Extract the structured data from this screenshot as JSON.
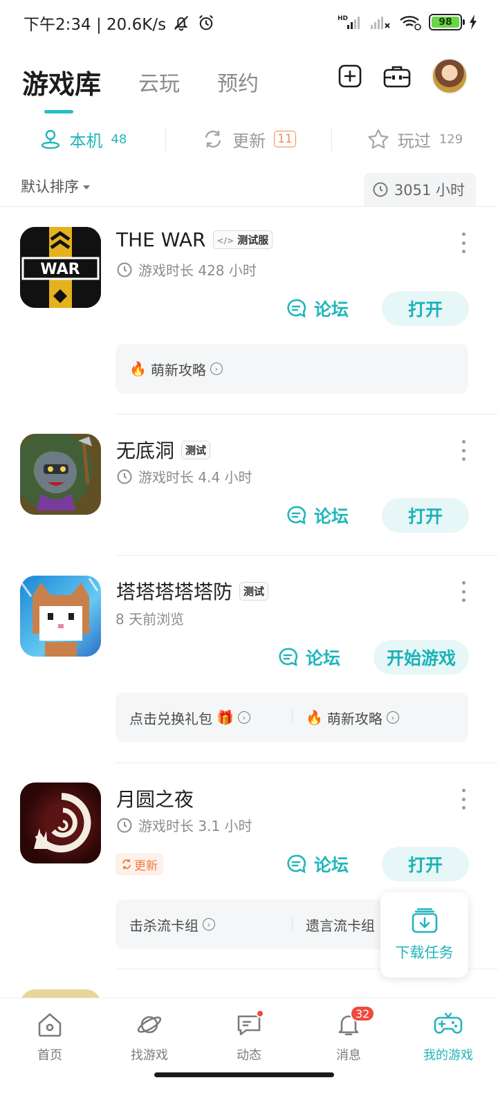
{
  "status_bar": {
    "time_speed": "下午2:34 | 20.6K/s",
    "battery": "98",
    "network": "HD"
  },
  "top_tabs": [
    {
      "label": "游戏库",
      "active": true
    },
    {
      "label": "云玩",
      "active": false
    },
    {
      "label": "预约",
      "active": false
    }
  ],
  "top_actions": {
    "add_icon": "plus-square-icon",
    "toolbox_icon": "toolbox-icon"
  },
  "sub_tabs": [
    {
      "label": "本机",
      "count": "48",
      "icon": "phone-user-icon",
      "active": true
    },
    {
      "label": "更新",
      "count": "11",
      "icon": "refresh-icon",
      "active": false
    },
    {
      "label": "玩过",
      "count": "129",
      "icon": "star-icon",
      "active": false
    }
  ],
  "sort": {
    "label": "默认排序",
    "total_time": "3051 小时"
  },
  "games": [
    {
      "title": "THE WAR",
      "tag": "测试服",
      "meta": "游戏时长 428 小时",
      "forum": "论坛",
      "action": "打开",
      "guides": [
        "萌新攻略"
      ]
    },
    {
      "title": "无底洞",
      "tag": "测试",
      "meta": "游戏时长 4.4 小时",
      "forum": "论坛",
      "action": "打开",
      "guides": []
    },
    {
      "title": "塔塔塔塔塔防",
      "tag": "测试",
      "meta": "8 天前浏览",
      "forum": "论坛",
      "action": "开始游戏",
      "guides": [
        "点击兑换礼包",
        "萌新攻略"
      ]
    },
    {
      "title": "月圆之夜",
      "tag": "",
      "meta": "游戏时长 3.1 小时",
      "update": "更新",
      "forum": "论坛",
      "action": "打开",
      "guides": [
        "击杀流卡组",
        "遗言流卡组"
      ]
    }
  ],
  "download_fab": {
    "label": "下载任务"
  },
  "bottom_nav": [
    {
      "label": "首页",
      "icon": "home-icon",
      "active": false
    },
    {
      "label": "找游戏",
      "icon": "planet-icon",
      "active": false
    },
    {
      "label": "动态",
      "icon": "chat-icon",
      "active": false,
      "dot": true
    },
    {
      "label": "消息",
      "icon": "bell-icon",
      "active": false,
      "count": "32"
    },
    {
      "label": "我的游戏",
      "icon": "gamepad-icon",
      "active": true
    }
  ],
  "colors": {
    "accent": "#21b5bb",
    "orange": "#f08b55",
    "red": "#f04a3e"
  }
}
